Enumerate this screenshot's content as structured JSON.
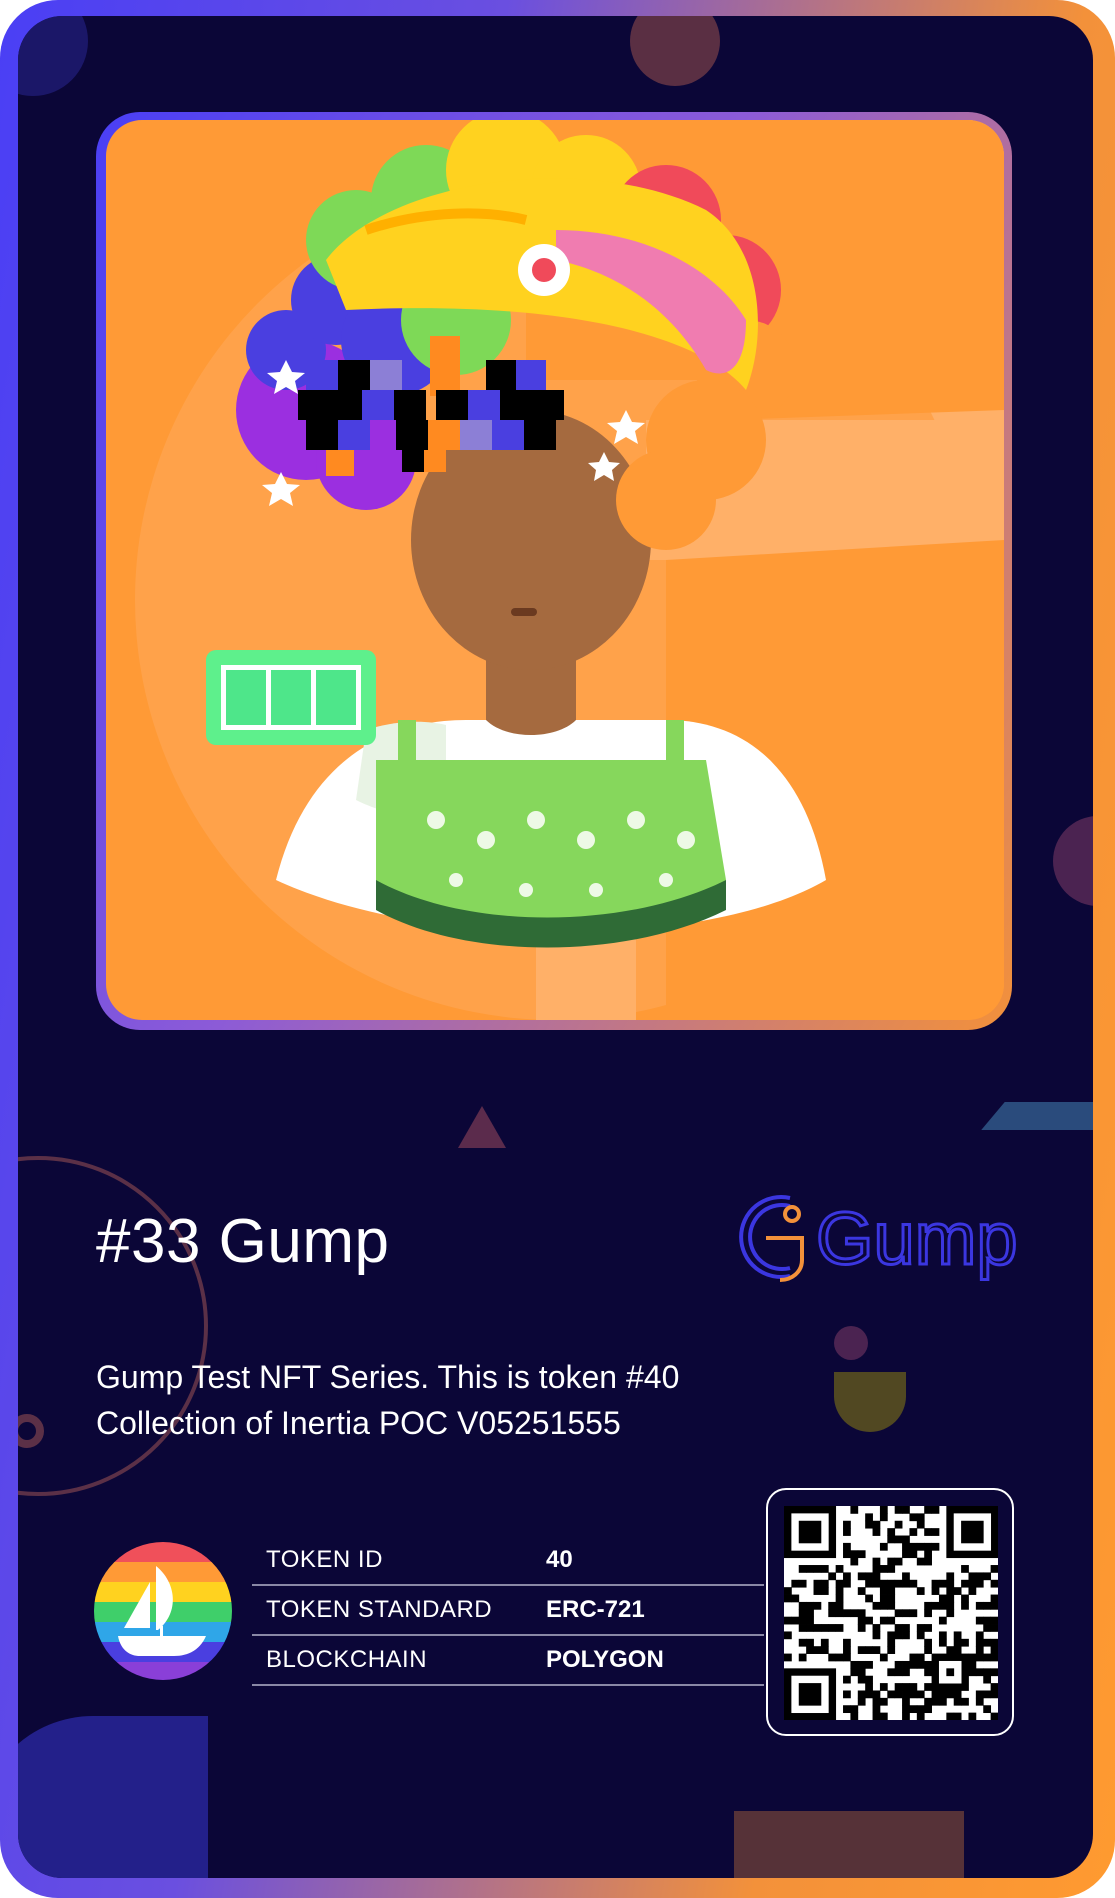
{
  "card": {
    "title": "#33 Gump",
    "description_line1": "Gump Test NFT Series. This is token #40",
    "description_line2": "Collection of Inertia POC V05251555",
    "brand": "Gump"
  },
  "details": [
    {
      "label": "TOKEN ID",
      "value": "40"
    },
    {
      "label": "TOKEN STANDARD",
      "value": "ERC-721"
    },
    {
      "label": "BLOCKCHAIN",
      "value": "POLYGON"
    }
  ],
  "icons": {
    "marketplace": "opensea-icon",
    "qr": "qr-code-icon",
    "battery": "battery-icon"
  },
  "colors": {
    "card_background": "#0b0637",
    "border_start": "#4a3ff5",
    "border_end": "#ff9a30",
    "art_background": "#ff9a30",
    "logo_blue": "#3b36e0",
    "logo_orange": "#f3913a"
  }
}
